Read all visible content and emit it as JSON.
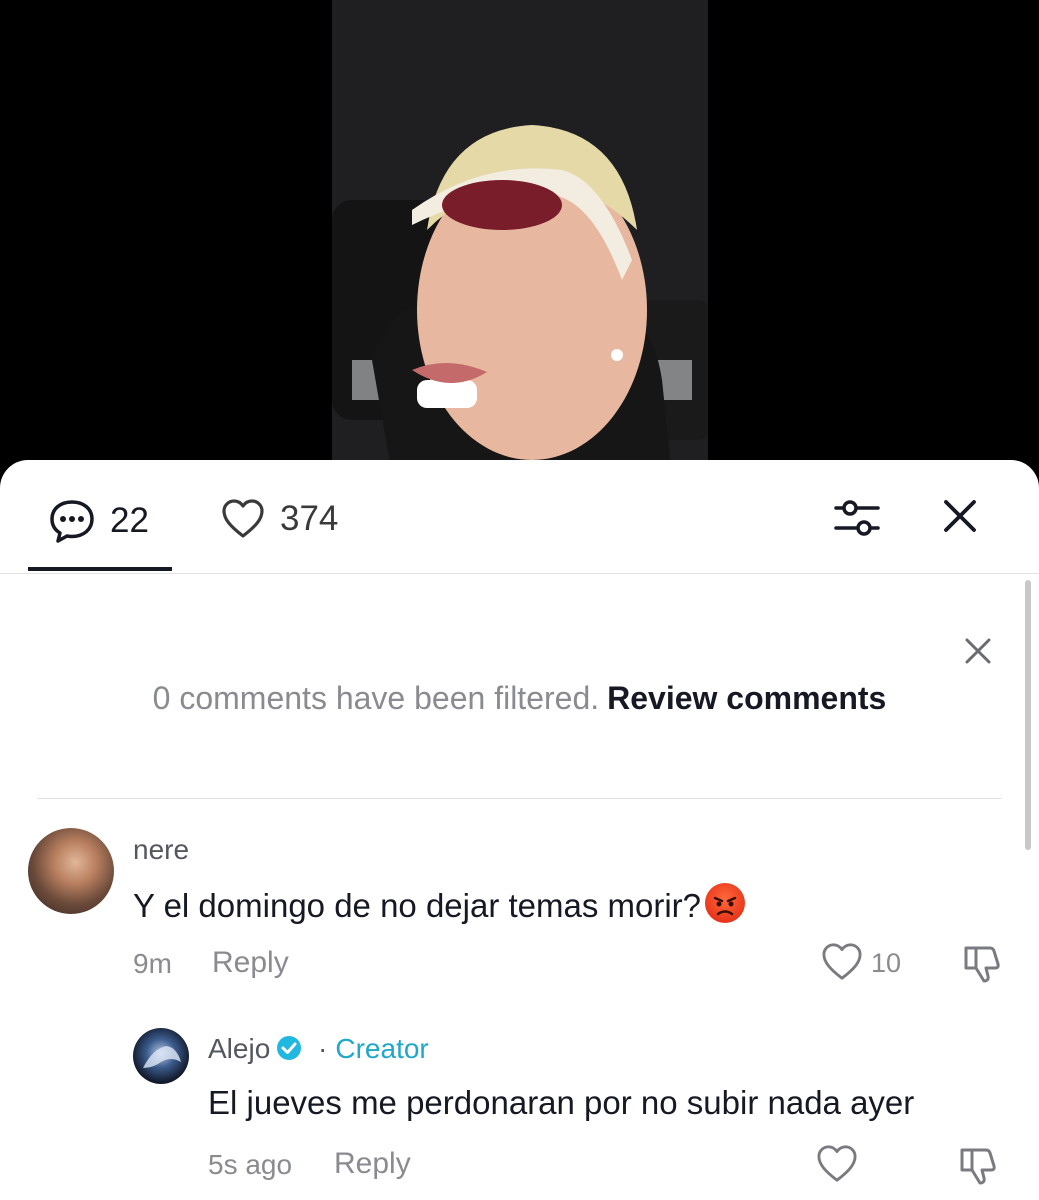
{
  "tabs": {
    "comments_count": "22",
    "likes_count": "374"
  },
  "notice": {
    "text": "0 comments have been filtered.",
    "link": "Review comments"
  },
  "comments": [
    {
      "username": "nere",
      "text": "Y el domingo de no dejar temas morir?",
      "time": "9m",
      "reply_label": "Reply",
      "likes": "10"
    }
  ],
  "replies": [
    {
      "username": "Alejo",
      "separator": "·",
      "badge": "Creator",
      "text": "El jueves me perdonaran por no subir nada ayer",
      "time": "5s ago",
      "reply_label": "Reply"
    }
  ],
  "colors": {
    "accent": "#20a7c9",
    "text": "#161823",
    "muted": "#8a8b91"
  },
  "icons": [
    "comment-icon",
    "heart-icon",
    "filter-icon",
    "close-icon",
    "dislike-icon",
    "verified-icon",
    "angry-emoji"
  ]
}
